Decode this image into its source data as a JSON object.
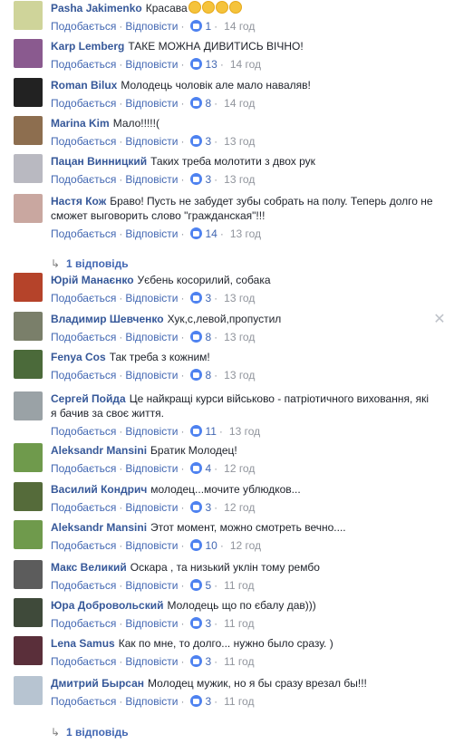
{
  "actions": {
    "like": "Подобається",
    "reply": "Відповісти"
  },
  "comments": [
    {
      "name": "Pasha Jakimenko",
      "text": "Красава",
      "likes": "1",
      "time": "14 год",
      "avatar_color": "#cfd49a",
      "emoji": [
        "flexed-biceps-icon",
        "clapping-hands-icon",
        "clapping-hands-icon",
        "clapping-hands-icon"
      ]
    },
    {
      "name": "Karp Lemberg",
      "text": "ТАКЕ МОЖНА ДИВИТИСЬ ВІЧНО!",
      "likes": "13",
      "time": "14 год",
      "avatar_color": "#8a5a8f"
    },
    {
      "name": "Roman Bilux",
      "text": "Молодець чоловік але мало наваляв!",
      "likes": "8",
      "time": "14 год",
      "avatar_color": "#222222"
    },
    {
      "name": "Marina Kim",
      "text": "Мало!!!!!(",
      "likes": "3",
      "time": "13 год",
      "avatar_color": "#8d6e4f"
    },
    {
      "name": "Пацан Винницкий",
      "text": "Таких треба молотити з двох рук",
      "likes": "3",
      "time": "13 год",
      "avatar_color": "#b9b9c1"
    },
    {
      "name": "Настя Кож",
      "text": "Браво! Пусть не забудет зубы собрать на полу. Теперь долго не сможет выговорить слово \"гражданская\"!!!",
      "likes": "14",
      "time": "13 год",
      "avatar_color": "#c9a7a0"
    },
    {
      "name": "Юрій Манаєнко",
      "text": "Уєбень косорилий, собака",
      "likes": "3",
      "time": "13 год",
      "avatar_color": "#b5432a"
    },
    {
      "name": "Владимир Шевченко",
      "text": "Хук,с,левой,пропустил",
      "likes": "8",
      "time": "13 год",
      "avatar_color": "#7a7f6a"
    },
    {
      "name": "Fenya Cos",
      "text": "Так треба з кожним!",
      "likes": "8",
      "time": "13 год",
      "avatar_color": "#4b6a3a"
    },
    {
      "name": "Сергей Пойда",
      "text": "Це найкращі курси військово - патріотичного виховання, які я бачив за своє життя.",
      "likes": "11",
      "time": "13 год",
      "avatar_color": "#9aa2a6"
    },
    {
      "name": "Aleksandr Mansini",
      "text": "Братик Молодец!",
      "likes": "4",
      "time": "12 год",
      "avatar_color": "#6f9a4c"
    },
    {
      "name": "Василий Кондрич",
      "text": "молодец...мочите ублюдков...",
      "likes": "3",
      "time": "12 год",
      "avatar_color": "#556b3a"
    },
    {
      "name": "Aleksandr Mansini",
      "text": "Этот момент, можно смотреть вечно....",
      "likes": "10",
      "time": "12 год",
      "avatar_color": "#6f9a4c"
    },
    {
      "name": "Макс Великий",
      "text": "Оскара , та низький уклін тому рембо",
      "likes": "5",
      "time": "11 год",
      "avatar_color": "#5c5c5c"
    },
    {
      "name": "Юра Добровольский",
      "text": "Молодець що по єбалу дав)))",
      "likes": "3",
      "time": "11 год",
      "avatar_color": "#3f4a3a"
    },
    {
      "name": "Lena Samus",
      "text": "Как по мне, то долго... нужно было сразу. )",
      "likes": "3",
      "time": "11 год",
      "avatar_color": "#5a2f3a"
    },
    {
      "name": "Дмитрий Бырсан",
      "text": "Молодец мужик, но я бы сразу врезал бы!!!",
      "likes": "3",
      "time": "11 год",
      "avatar_color": "#b7c4d1"
    }
  ],
  "replies": [
    {
      "label": "1 відповідь"
    },
    {
      "label": "1 відповідь"
    }
  ]
}
